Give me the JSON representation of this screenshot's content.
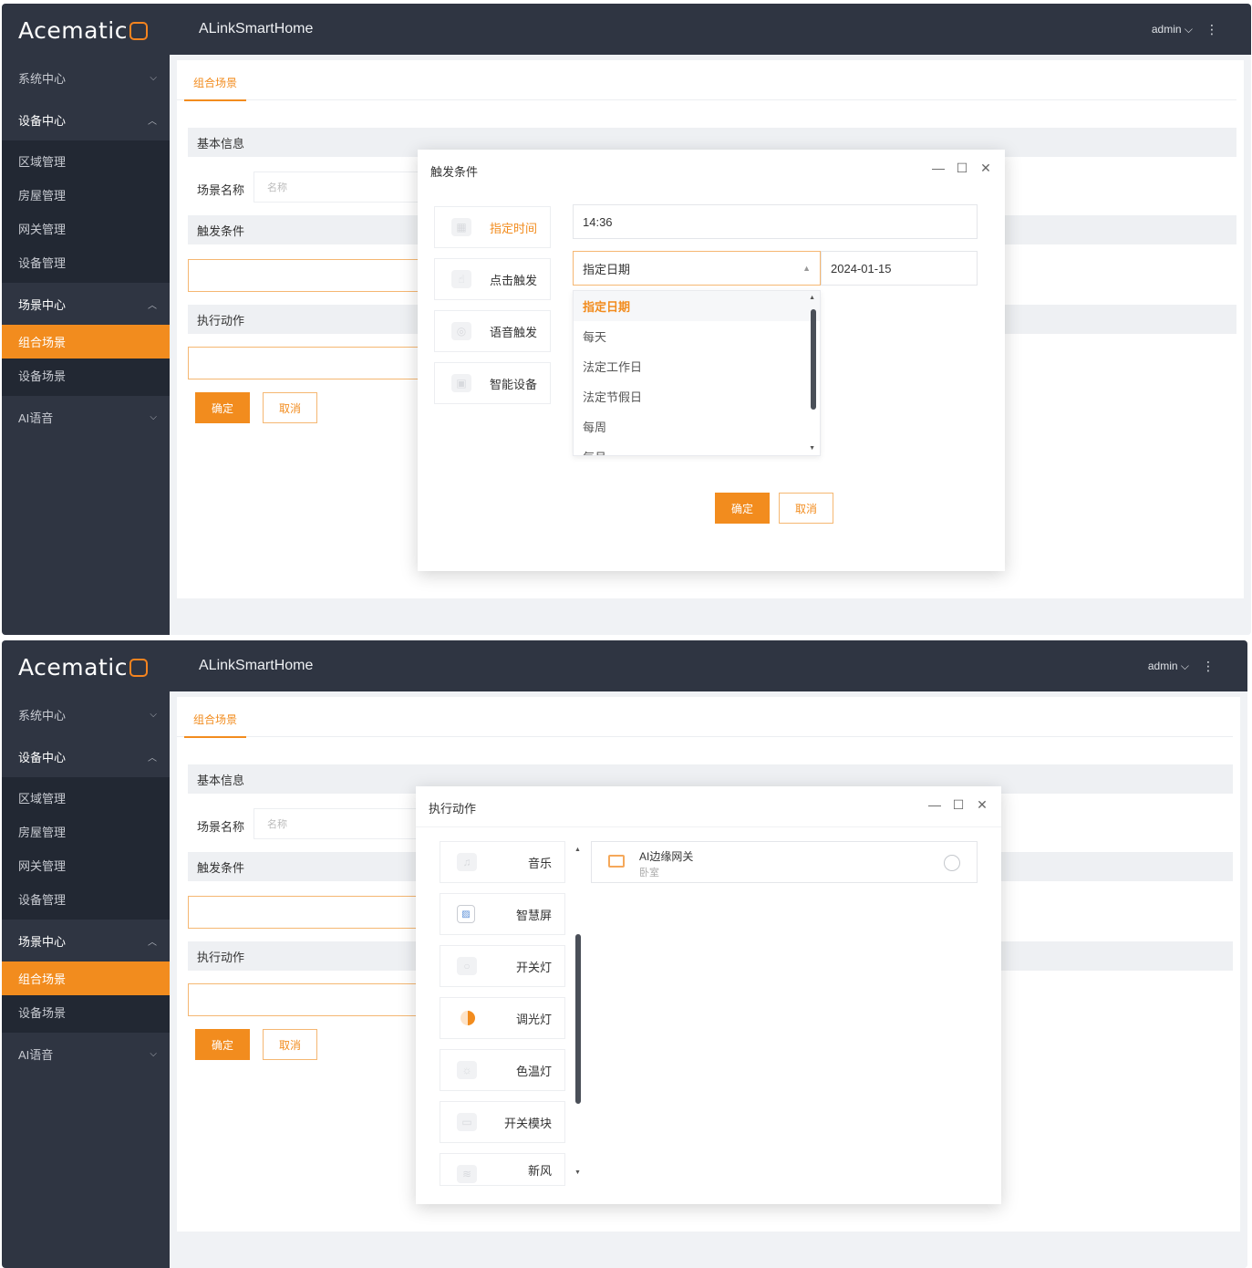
{
  "brand": {
    "logo_text": "Acematic",
    "accent": "#f28c1e",
    "sidebar_bg": "#2f3542"
  },
  "header": {
    "app_title": "ALinkSmartHome",
    "user": "admin ⌵",
    "more_icon": "⋮"
  },
  "sidebar": {
    "groups": [
      {
        "label": "系统中心",
        "chevron": "⌵"
      },
      {
        "label": "设备中心",
        "chevron": "︿"
      },
      {
        "label": "场景中心",
        "chevron": "︿"
      },
      {
        "label": "AI语音",
        "chevron": "⌵"
      }
    ],
    "device_items": [
      "区域管理",
      "房屋管理",
      "网关管理",
      "设备管理"
    ],
    "scene_items": [
      "组合场景",
      "设备场景"
    ]
  },
  "main": {
    "tab": "组合场景",
    "sections": {
      "basic": "基本信息",
      "trigger": "触发条件",
      "action": "执行动作"
    },
    "scene_name_label": "场景名称",
    "scene_name_placeholder": "名称",
    "confirm": "确定",
    "cancel": "取消"
  },
  "trigger_dialog": {
    "title": "触发条件",
    "controls": [
      "—",
      "☐",
      "✕"
    ],
    "types": [
      "指定时间",
      "点击触发",
      "语音触发",
      "智能设备"
    ],
    "time_value": "14:36",
    "date_mode": "指定日期",
    "date_value": "2024-01-15",
    "options": [
      "指定日期",
      "每天",
      "法定工作日",
      "法定节假日",
      "每周",
      "每月"
    ],
    "confirm": "确定",
    "cancel": "取消"
  },
  "action_dialog": {
    "title": "执行动作",
    "controls": [
      "—",
      "☐",
      "✕"
    ],
    "types": [
      "音乐",
      "智慧屏",
      "开关灯",
      "调光灯",
      "色温灯",
      "开关模块",
      "新风"
    ],
    "device": {
      "name": "AI边缘网关",
      "room": "卧室"
    }
  }
}
